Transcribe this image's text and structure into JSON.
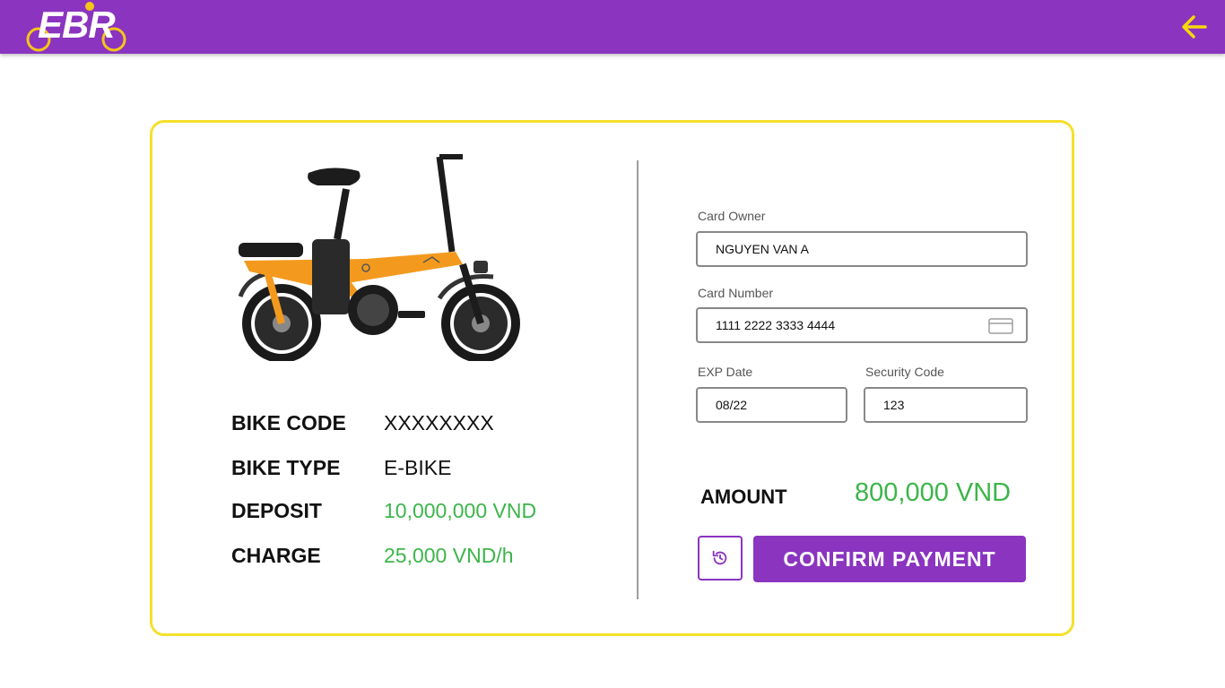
{
  "header": {
    "logo_text": "EBR",
    "back_icon": "arrow-left-icon",
    "accent_color": "#8b34c0",
    "icon_color": "#f5d90a"
  },
  "bike": {
    "image": "orange-electric-bike",
    "details": [
      {
        "label": "BIKE CODE",
        "value": "XXXXXXXX"
      },
      {
        "label": "BIKE TYPE",
        "value": "E-BIKE"
      },
      {
        "label": "DEPOSIT",
        "value": "10,000,000 VND"
      },
      {
        "label": "CHARGE",
        "value": "25,000 VND/h"
      }
    ]
  },
  "payment": {
    "card_owner": {
      "label": "Card Owner",
      "value": "NGUYEN VAN A"
    },
    "card_number": {
      "label": "Card Number",
      "value": "1111 2222 3333 4444",
      "icon": "credit-card-icon"
    },
    "exp_date": {
      "label": "EXP Date",
      "value": "08/22"
    },
    "security_code": {
      "label": "Security Code",
      "value": "123"
    },
    "amount_label": "AMOUNT",
    "amount_value": "800,000 VND",
    "reset_icon": "reset-icon",
    "confirm_label": "CONFIRM PAYMENT"
  },
  "colors": {
    "card_border": "#f5e02a",
    "money_green": "#3cb54a"
  }
}
